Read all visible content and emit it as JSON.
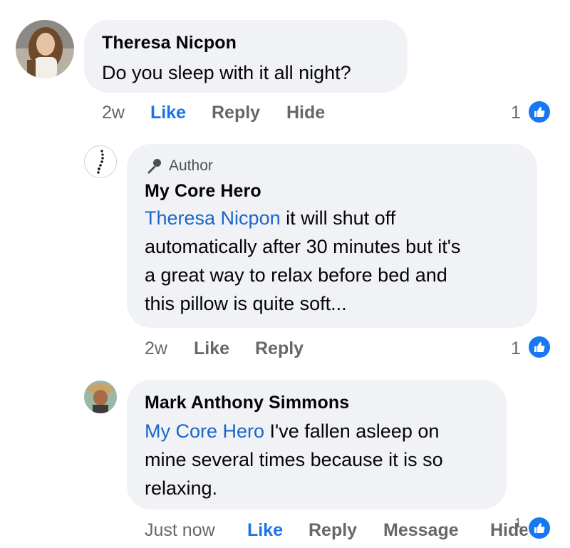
{
  "comments": [
    {
      "author": "Theresa Nicpon",
      "text": "Do you sleep with it all night?",
      "time": "2w",
      "actions": [
        "Like",
        "Reply",
        "Hide"
      ],
      "reaction_count": "1",
      "avatar_icon": "profile-photo-woman"
    },
    {
      "badge": "Author",
      "author": "My Core Hero",
      "mention": "Theresa Nicpon",
      "lines": [
        " it will shut off",
        "automatically after 30 minutes but it's",
        "a great way to relax before bed and",
        "this pillow is quite soft..."
      ],
      "time": "2w",
      "actions": [
        "Like",
        "Reply"
      ],
      "reaction_count": "1",
      "avatar_icon": "spine-logo"
    },
    {
      "author": "Mark Anthony Simmons",
      "mention": "My Core Hero",
      "lines": [
        " I've fallen asleep on",
        "mine several times because it is so",
        "relaxing."
      ],
      "time": "Just now",
      "actions": [
        "Like",
        "Reply",
        "Message",
        "Hide"
      ],
      "reaction_count": "1",
      "avatar_icon": "profile-photo-man-hat"
    }
  ],
  "colors": {
    "accent": "#1877f2",
    "mention": "#1a66c9",
    "bubble": "#f0f2f5",
    "meta": "#65676b"
  }
}
